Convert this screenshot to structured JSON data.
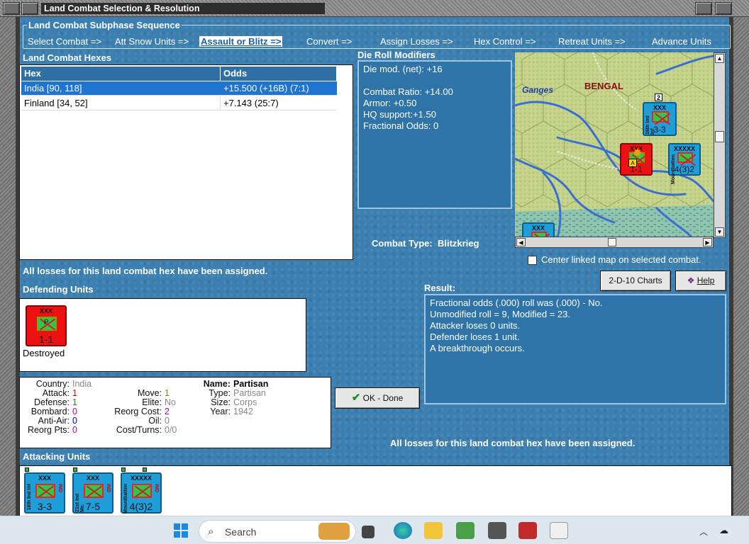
{
  "window": {
    "title": "Land Combat Selection & Resolution"
  },
  "subphase": {
    "title": "Land Combat Subphase Sequence",
    "steps": [
      "Select Combat =>",
      "Att Snow Units =>",
      "Assault or Blitz =>",
      "Convert =>",
      "Assign Losses =>",
      "Hex Control =>",
      "Retreat Units =>",
      "Advance Units"
    ],
    "active_step": "Assault or Blitz =>"
  },
  "hexes": {
    "label": "Land Combat Hexes",
    "columns": [
      "Hex",
      "Odds"
    ],
    "rows": [
      {
        "hex": "India [90, 118]",
        "odds": "+15.500 (+16B) (7:1)"
      },
      {
        "hex": "Finland [34, 52]",
        "odds": "+7.143 (25:7)"
      }
    ]
  },
  "die_roll": {
    "label": "Die Roll Modifiers",
    "net": "Die mod. (net): +16",
    "lines": [
      "Combat Ratio: +14.00",
      "Armor: +0.50",
      "HQ support:+1.50",
      "Fractional Odds: 0"
    ]
  },
  "combat_type": {
    "label": "Combat Type:",
    "value": "Blitzkrieg"
  },
  "map": {
    "labels": {
      "river": "Ganges",
      "region": "BENGAL"
    },
    "center_checkbox": "Center linked map on selected combat.",
    "counters": [
      {
        "size": "XXX",
        "strength": "3-3",
        "side": "16th Ind Inf",
        "stack": "2"
      },
      {
        "size": "XXXXX",
        "strength": "4(3)2",
        "side": "Mountbatten"
      },
      {
        "size": "XXX",
        "strength": "1-1",
        "badge": "A"
      },
      {
        "size": "XXX",
        "strength": ""
      }
    ]
  },
  "buttons": {
    "charts": "2-D-10 Charts",
    "help": "Help",
    "ok": "OK - Done"
  },
  "losses_msg_top": "All losses for this land combat hex have been assigned.",
  "losses_msg_bottom": "All losses for this land combat hex have been assigned.",
  "defending": {
    "label": "Defending Units",
    "unit": {
      "size": "XXX",
      "symbol": "P",
      "strength": "1-1",
      "status": "Destroyed"
    }
  },
  "result": {
    "label": "Result:",
    "lines": [
      "Fractional odds (.000) roll was (.000)  - No.",
      "Unmodified roll = 9, Modified = 23.",
      "Attacker loses 0 units.",
      "Defender loses 1 unit.",
      "A breakthrough occurs."
    ]
  },
  "unit_info": {
    "country_k": "Country:",
    "country": "India",
    "attack_k": "Attack:",
    "attack": "1",
    "defense_k": "Defense:",
    "defense": "1",
    "bombard_k": "Bombard:",
    "bombard": "0",
    "antiair_k": "Anti-Air:",
    "antiair": "0",
    "reorgpts_k": "Reorg Pts:",
    "reorgpts": "0",
    "move_k": "Move:",
    "move": "1",
    "elite_k": "Elite:",
    "elite": "No",
    "reorgcost_k": "Reorg Cost:",
    "reorgcost": "2",
    "oil_k": "Oil:",
    "oil": "0",
    "costturns_k": "Cost/Turns:",
    "costturns": "0/0",
    "name_k": "Name:",
    "name": "Partisan",
    "type_k": "Type:",
    "type": "Partisan",
    "size_k": "Size:",
    "size": "Corps",
    "year_k": "Year:",
    "year": "1942"
  },
  "attacking": {
    "label": "Attacking Units",
    "units": [
      {
        "size": "XXX",
        "strength": "3-3",
        "side": "16th Ind Inf",
        "nat": "IND"
      },
      {
        "size": "XXX",
        "strength": "7-5",
        "side": "21st Ind Me.",
        "nat": "IND"
      },
      {
        "size": "XXXXX",
        "strength": "4(3)2",
        "side": "Mountbatten",
        "nat": "IND"
      }
    ]
  },
  "taskbar": {
    "search_placeholder": "Search"
  },
  "colors": {
    "panel_blue": "#2f74a8",
    "selected_row": "#1e74d0",
    "attack_red": "#cc0000",
    "defense_green": "#118811",
    "bombard_purple": "#aa00aa",
    "antiair_blue": "#0000cc"
  }
}
